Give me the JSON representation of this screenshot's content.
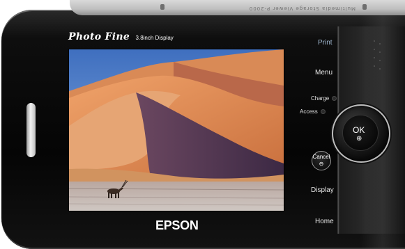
{
  "device": {
    "brand_name": "Photo Fine",
    "brand_tagline": "3.8inch Display",
    "maker": "EPSON",
    "top_engraving": "Multimedia Storage Viewer P-2000"
  },
  "buttons": {
    "print": "Print",
    "menu": "Menu",
    "ok": "OK",
    "ok_icon": "⊕",
    "cancel": "Cancel",
    "cancel_icon": "⊖",
    "display": "Display",
    "home": "Home"
  },
  "indicators": {
    "charge": "Charge",
    "access": "Access"
  },
  "screen": {
    "image_subject": "desert-dunes-with-oryx"
  },
  "colors": {
    "body": "#0a0a0a",
    "print_label": "#9fb7cf",
    "sky": "#5f8fd2",
    "dune_light": "#e49a63",
    "dune_shadow": "#5a3a55"
  }
}
